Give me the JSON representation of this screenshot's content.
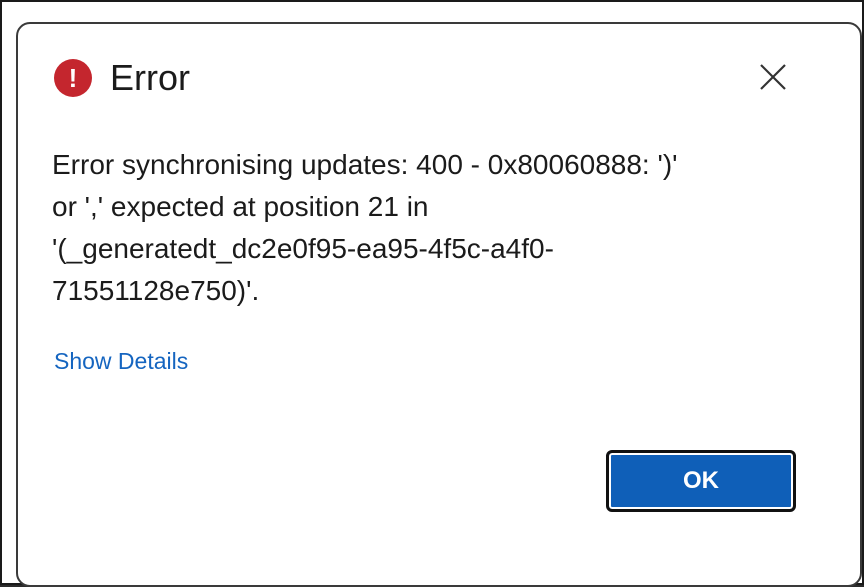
{
  "dialog": {
    "title": "Error",
    "icon": "error-icon",
    "icon_glyph": "!",
    "icon_color": "#c4262e",
    "close_icon": "close-icon",
    "message": "Error synchronising updates: 400 - 0x80060888: ')'\nor ',' expected at position 21 in\n'(_generatedt_dc2e0f95-ea95-4f5c-a4f0-\n71551128e750)'.",
    "details_link": "Show Details",
    "ok_label": "OK",
    "accent_color": "#0f5fb8"
  }
}
